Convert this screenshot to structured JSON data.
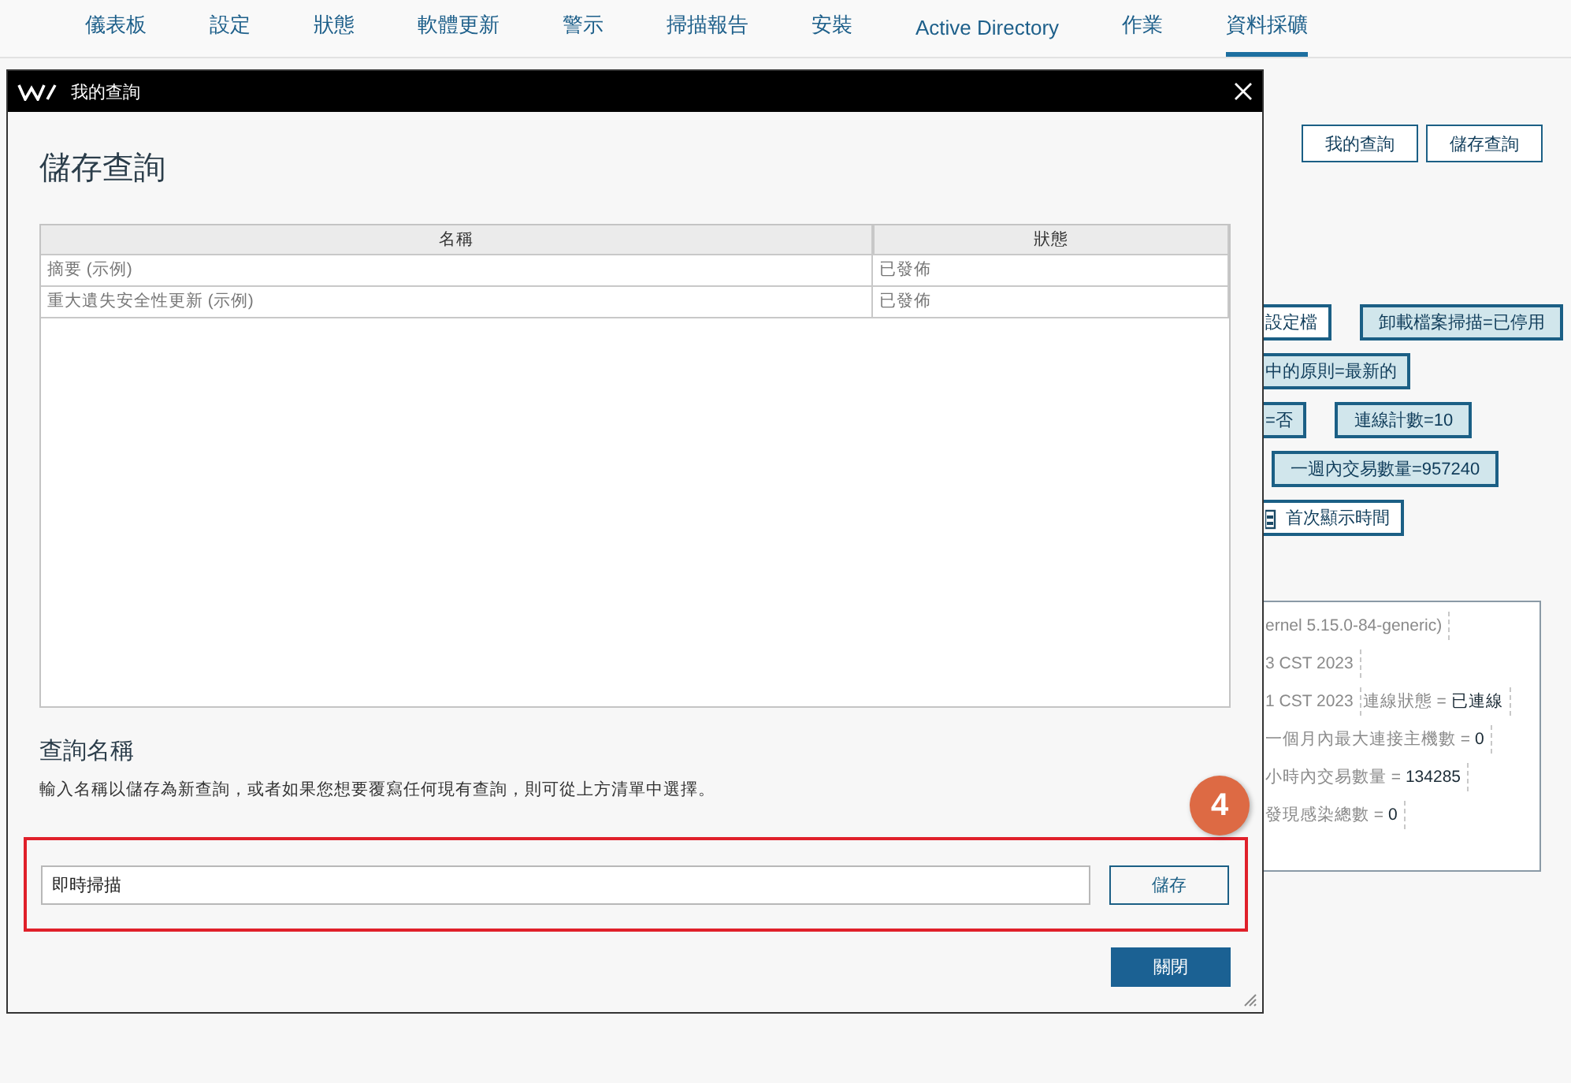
{
  "nav": {
    "tabs": [
      {
        "label": "儀表板",
        "selected": false
      },
      {
        "label": "設定",
        "selected": false
      },
      {
        "label": "狀態",
        "selected": false
      },
      {
        "label": "軟體更新",
        "selected": false
      },
      {
        "label": "警示",
        "selected": false
      },
      {
        "label": "掃描報告",
        "selected": false
      },
      {
        "label": "安裝",
        "selected": false
      },
      {
        "label": "Active Directory",
        "selected": false
      },
      {
        "label": "作業",
        "selected": false
      },
      {
        "label": "資料採礦",
        "selected": true
      }
    ]
  },
  "toolbar": {
    "buttons": [
      "我的查詢",
      "儲存查詢"
    ]
  },
  "tag_rows": [
    {
      "tags": [
        {
          "kind": "filter",
          "label": "設定檔",
          "cut": true,
          "highlighted": false
        },
        {
          "kind": "filter",
          "label": "卸載檔案掃描=已停用",
          "cut": false,
          "highlighted": true
        }
      ]
    },
    {
      "tags": [
        {
          "kind": "filter",
          "label": "中的原則=最新的",
          "cut": true,
          "highlighted": true
        }
      ]
    },
    {
      "tags": [
        {
          "kind": "filter",
          "label": "=否",
          "cut": true,
          "highlighted": true
        },
        {
          "kind": "filter",
          "label": "連線計數=10",
          "cut": false,
          "highlighted": true
        }
      ]
    },
    {
      "tags": [
        {
          "kind": "filter",
          "label": "一週內交易數量=957240",
          "cut": false,
          "highlighted": true
        }
      ]
    },
    {
      "tags": [
        {
          "kind": "date",
          "label": "首次顯示時間",
          "cut": true,
          "highlighted": false
        }
      ]
    }
  ],
  "info_panel": {
    "lines": [
      [
        {
          "label": "ernel 5.15.0-84-generic)"
        }
      ],
      [
        {
          "label": "3 CST 2023"
        }
      ],
      [
        {
          "label": "1 CST 2023"
        },
        {
          "label": "連線狀態 = ",
          "value": "已連線"
        }
      ],
      [
        {
          "label": "一個月內最大連接主機數 = ",
          "value": "0"
        }
      ],
      [
        {
          "label": "小時內交易數量 = ",
          "value": "134285"
        }
      ],
      [
        {
          "label": "發現感染總數 = ",
          "value": "0"
        }
      ]
    ]
  },
  "dialog": {
    "title": "我的查詢",
    "heading": "儲存查詢",
    "table": {
      "columns": [
        "名稱",
        "狀態"
      ],
      "rows": [
        [
          "摘要 (示例)",
          "已發佈"
        ],
        [
          "重大遺失安全性更新 (示例)",
          "已發佈"
        ]
      ]
    },
    "query_name": {
      "heading": "查詢名稱",
      "description": "輸入名稱以儲存為新查詢，或者如果您想要覆寫任何現有查詢，則可從上方清單中選擇。",
      "value": "即時掃描",
      "save_button": "儲存"
    },
    "close_button": "關閉"
  },
  "annotation": {
    "step": "4"
  }
}
